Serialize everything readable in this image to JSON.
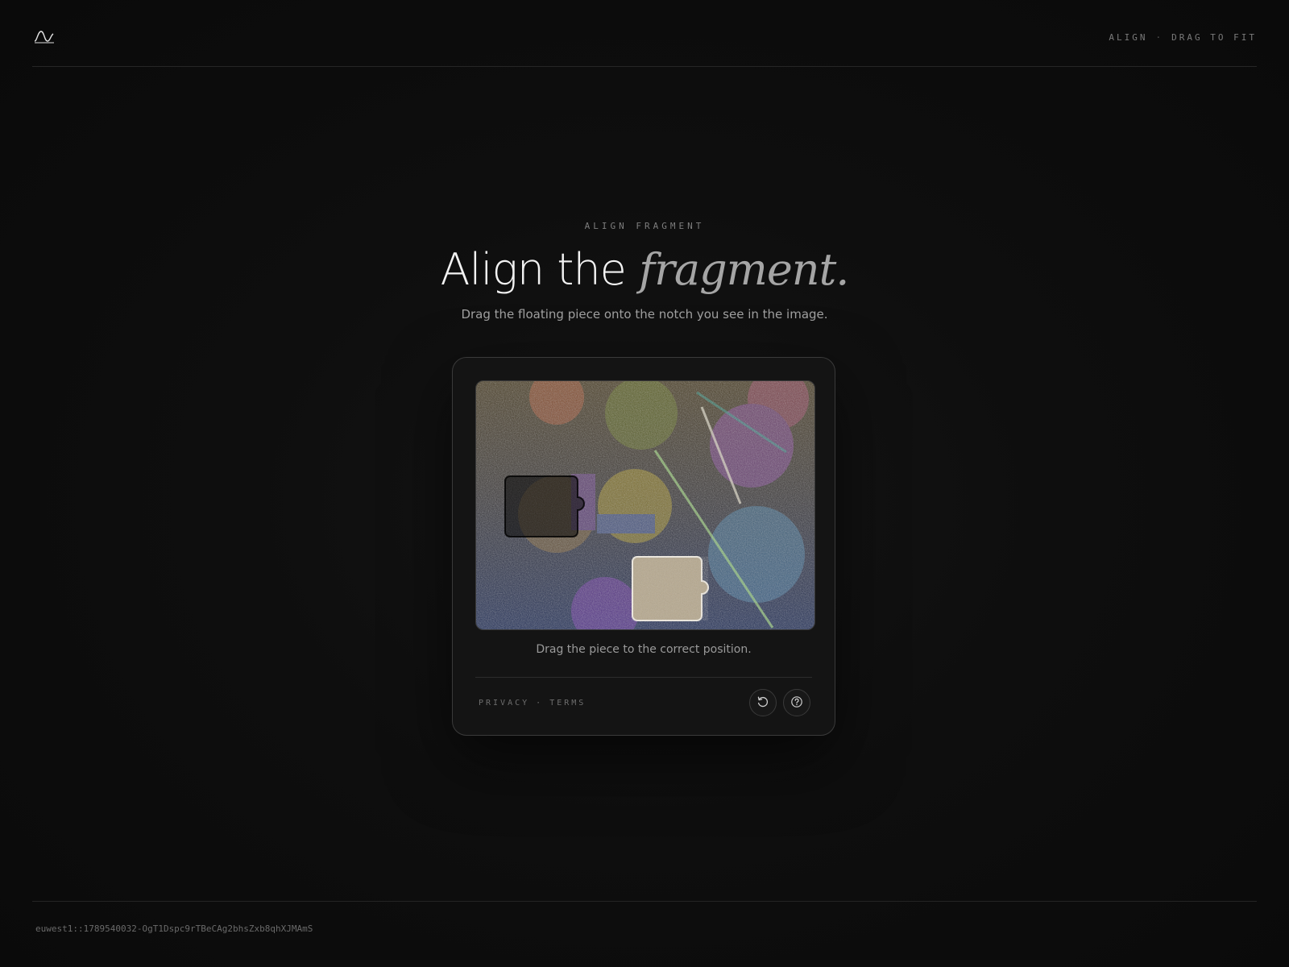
{
  "header": {
    "logo_icon": "wave-logo-icon",
    "mode_label": "ALIGN",
    "separator": "·",
    "instruction_label": "DRAG TO FIT"
  },
  "hero": {
    "eyebrow": "ALIGN FRAGMENT",
    "title_plain": "Align the ",
    "title_accent": "fragment.",
    "subtitle": "Drag the floating piece onto the notch you see in the image."
  },
  "challenge": {
    "hint": "Drag the piece to the correct position.",
    "legal": {
      "privacy": "PRIVACY",
      "separator": "·",
      "terms": "TERMS"
    },
    "refresh_icon": "refresh-icon",
    "help_icon": "help-circle-icon"
  },
  "footer": {
    "session_id": "euwest1::1789540032-OgT1Dspc9rTBeCAg2bhsZxb8qhXJMAmS"
  },
  "colors": {
    "background": "#0c0c0c",
    "card": "#141414",
    "border": "#3a3a3a",
    "text_primary": "#f2f2f2",
    "text_muted": "#9a9a9a"
  }
}
